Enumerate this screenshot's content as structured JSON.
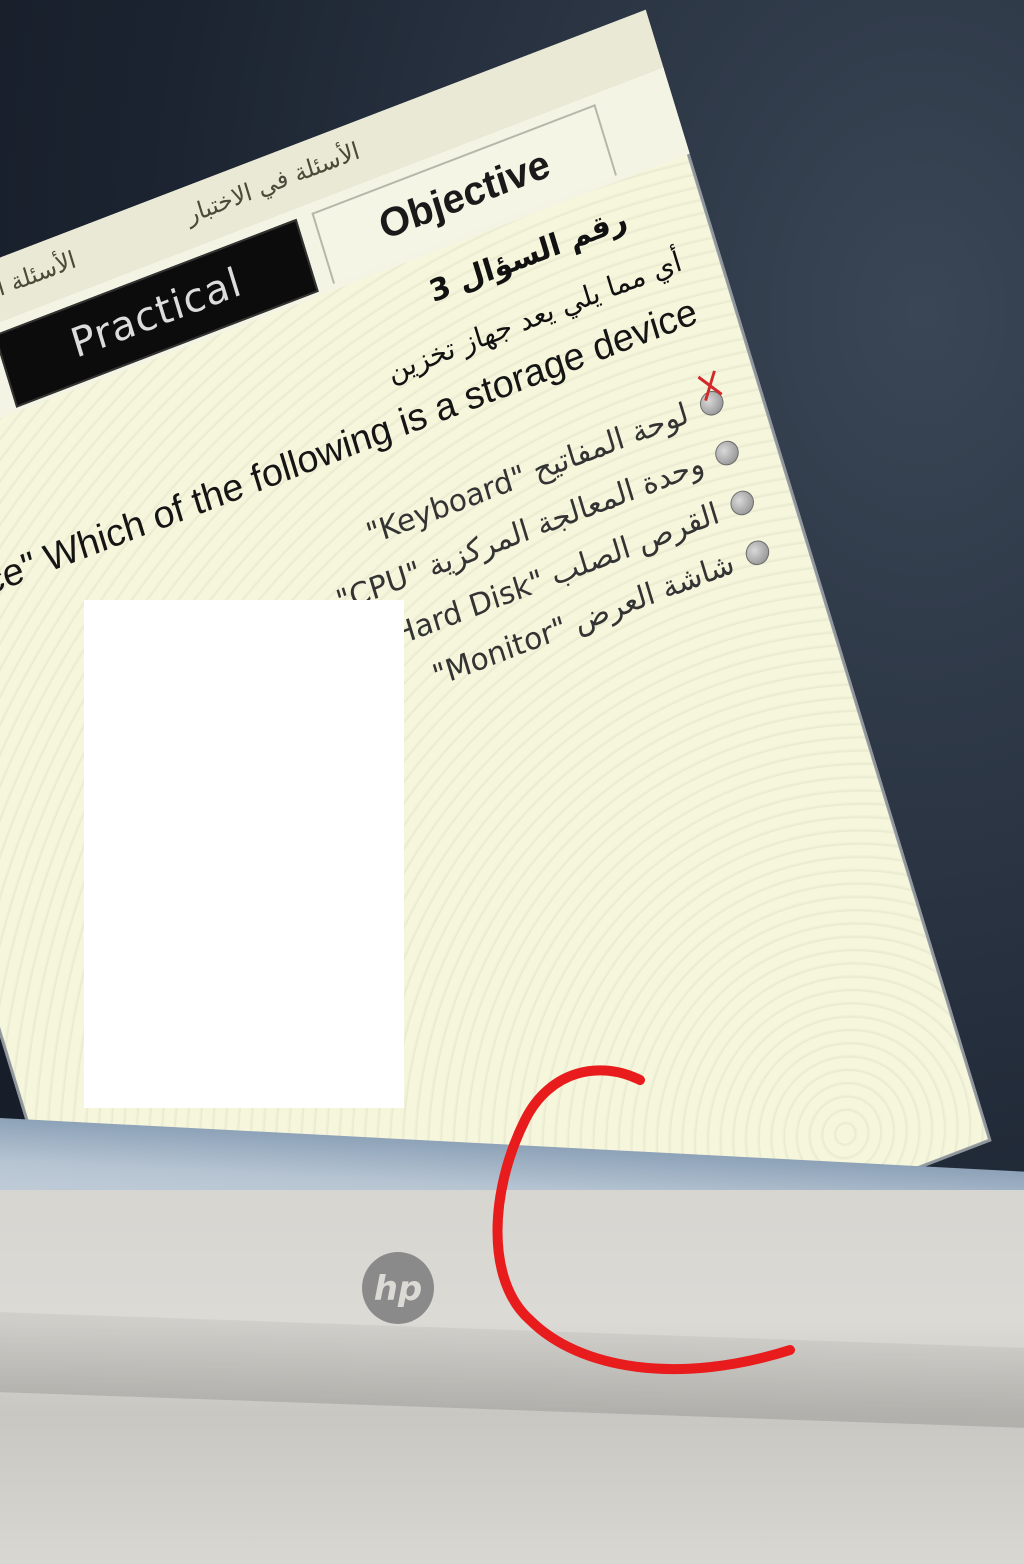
{
  "exam_window": {
    "top_tabs": [
      "الأسئلة المحلولة",
      "الأسئلة في الاختبار"
    ],
    "tabs": {
      "practical_label": "Practical",
      "objective_label": "Objective"
    },
    "question": {
      "number_label": "رقم السؤال 3",
      "text_ar": "أي مما يلي يعد جهاز تخزين",
      "text_en": "?\"Storage Device\" Which of the following is a storage device",
      "options": [
        {
          "label": "لوحة المفاتيح \"Keyboard\"",
          "marked_wrong": true
        },
        {
          "label": "وحدة المعالجة المركزية \"CPU\"",
          "marked_wrong": false
        },
        {
          "label": "القرص الصلب \"Hard Disk\"",
          "marked_wrong": false
        },
        {
          "label": "شاشة العرض \"Monitor\"",
          "marked_wrong": false
        }
      ]
    }
  },
  "taskbar": {
    "icons": [
      "winrar-icon",
      "internet-explorer-icon",
      "app-icon"
    ]
  },
  "laptop": {
    "brand_logo": "hp"
  },
  "colors": {
    "annotation_red": "#e81c1c",
    "practical_tab_bg": "#0c0c0c",
    "screen_bg": "#f6f6dc",
    "taskbar": "#b6c4d2"
  }
}
